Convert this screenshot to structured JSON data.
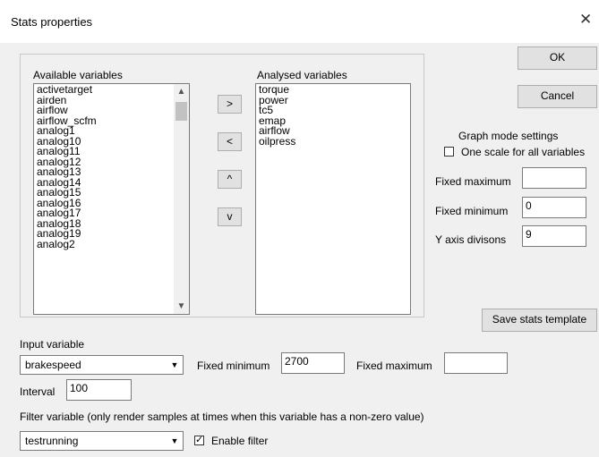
{
  "window": {
    "title": "Stats properties"
  },
  "available": {
    "label": "Available variables",
    "items": [
      "activetarget",
      "airden",
      "airflow",
      "airflow_scfm",
      "analog1",
      "analog10",
      "analog11",
      "analog12",
      "analog13",
      "analog14",
      "analog15",
      "analog16",
      "analog17",
      "analog18",
      "analog19",
      "analog2"
    ]
  },
  "analysed": {
    "label": "Analysed variables",
    "items": [
      "torque",
      "power",
      "tc5",
      "emap",
      "airflow",
      "oilpress"
    ]
  },
  "move_buttons": {
    "add": ">",
    "remove": "<",
    "up": "^",
    "down": "v"
  },
  "buttons": {
    "ok": "OK",
    "cancel": "Cancel",
    "save_template": "Save stats template"
  },
  "graph_mode": {
    "title": "Graph mode settings",
    "one_scale_label": "One scale for all variables",
    "one_scale_checked": false,
    "fixed_max_label": "Fixed maximum",
    "fixed_max_value": "",
    "fixed_min_label": "Fixed minimum",
    "fixed_min_value": "0",
    "y_div_label": "Y axis divisons",
    "y_div_value": "9"
  },
  "input_variable": {
    "label": "Input variable",
    "value": "brakespeed",
    "fixed_min_label": "Fixed minimum",
    "fixed_min_value": "2700",
    "fixed_max_label": "Fixed maximum",
    "fixed_max_value": "",
    "interval_label": "Interval",
    "interval_value": "100"
  },
  "filter": {
    "label": "Filter variable (only render samples at times when this variable has a non-zero value)",
    "value": "testrunning",
    "enable_label": "Enable filter",
    "enabled": true
  },
  "icons": {
    "close": "close-icon",
    "dropdown": "chevron-down-icon",
    "check": "check-icon"
  }
}
